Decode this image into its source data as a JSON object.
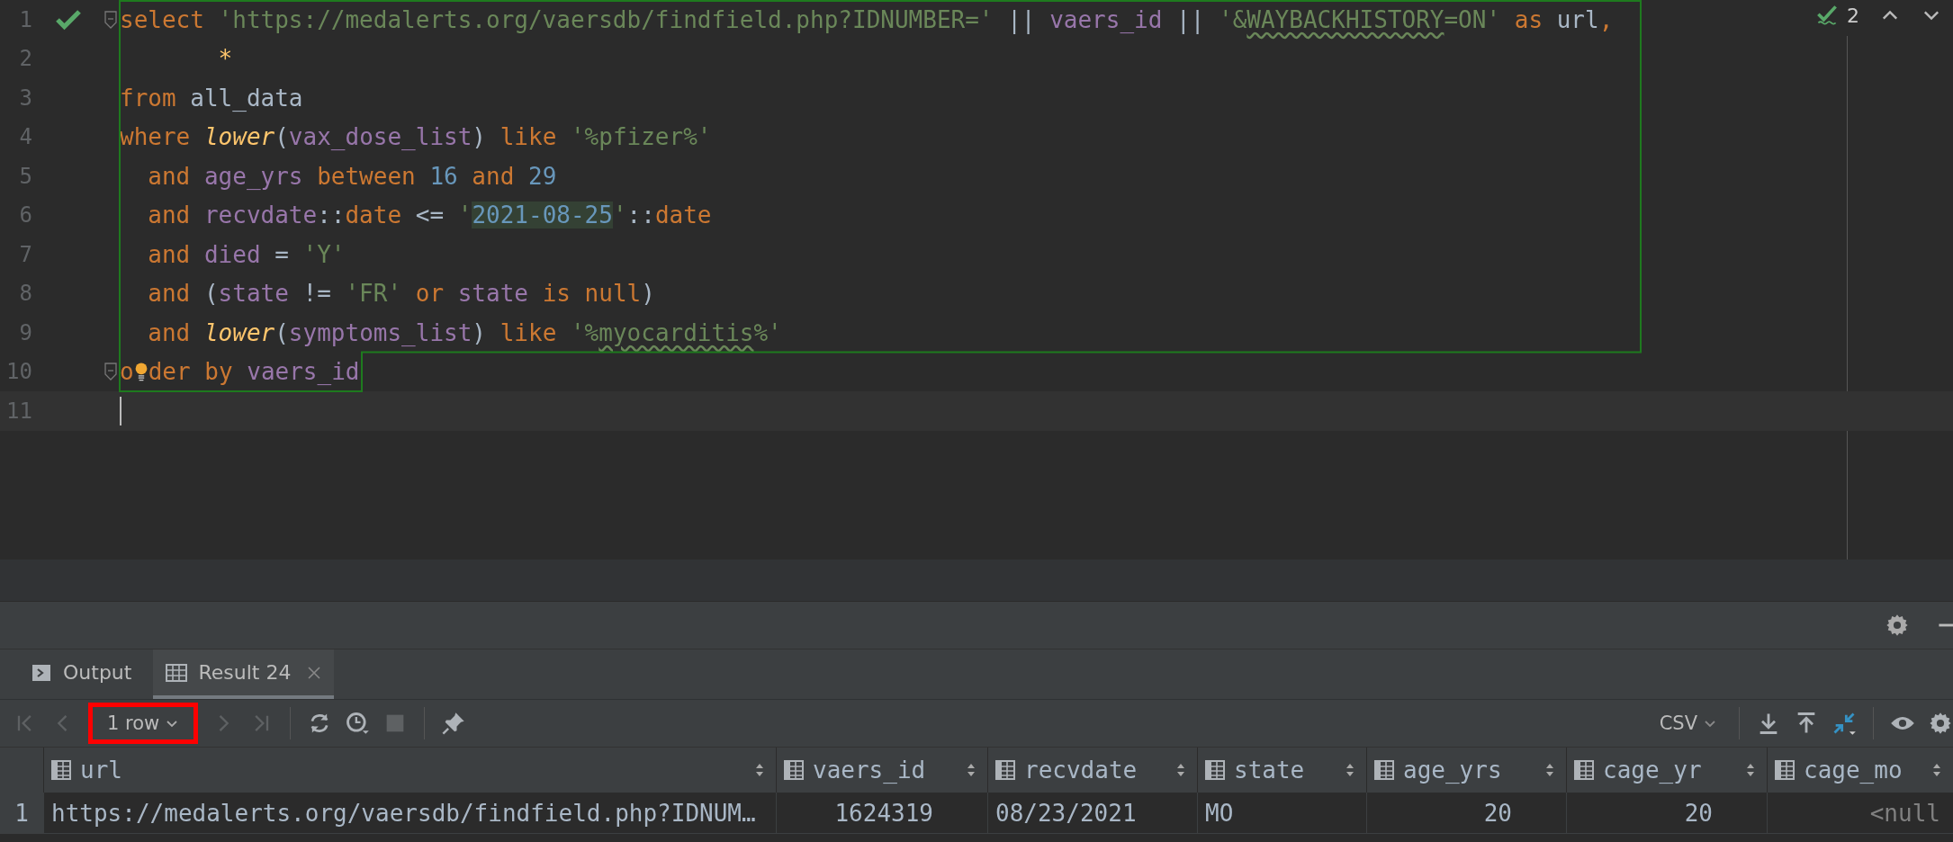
{
  "editor": {
    "lines": [
      {
        "number": "1",
        "ok_mark": true,
        "fold_marker": true,
        "tokens": [
          {
            "kind": "kw",
            "text": "select "
          },
          {
            "kind": "str",
            "text": "'https://medalerts.org/vaersdb/findfield.php?IDNUMBER=' "
          },
          {
            "kind": "plain",
            "text": "|| "
          },
          {
            "kind": "col",
            "text": "vaers_id "
          },
          {
            "kind": "plain",
            "text": "|| "
          },
          {
            "kind": "str",
            "text": "'&"
          },
          {
            "kind": "typo",
            "text": "WAYBACKHISTORY"
          },
          {
            "kind": "str",
            "text": "=ON' "
          },
          {
            "kind": "kw",
            "text": "as "
          },
          {
            "kind": "plain",
            "text": "url"
          },
          {
            "kind": "kw",
            "text": ","
          }
        ]
      },
      {
        "number": "2",
        "tokens": [
          {
            "kind": "star",
            "text": "       *"
          }
        ]
      },
      {
        "number": "3",
        "tokens": [
          {
            "kind": "kw",
            "text": "from "
          },
          {
            "kind": "plain",
            "text": "all_data"
          }
        ]
      },
      {
        "number": "4",
        "tokens": [
          {
            "kind": "kw",
            "text": "where "
          },
          {
            "kind": "fn",
            "text": "lower"
          },
          {
            "kind": "plain",
            "text": "("
          },
          {
            "kind": "col",
            "text": "vax_dose_list"
          },
          {
            "kind": "plain",
            "text": ") "
          },
          {
            "kind": "kw",
            "text": "like "
          },
          {
            "kind": "str",
            "text": "'%pfizer%'"
          }
        ]
      },
      {
        "number": "5",
        "tokens": [
          {
            "kind": "kw",
            "text": "  and "
          },
          {
            "kind": "col",
            "text": "age_yrs "
          },
          {
            "kind": "kw",
            "text": "between "
          },
          {
            "kind": "num",
            "text": "16 "
          },
          {
            "kind": "kw",
            "text": "and "
          },
          {
            "kind": "num",
            "text": "29"
          }
        ]
      },
      {
        "number": "6",
        "tokens": [
          {
            "kind": "kw",
            "text": "  and "
          },
          {
            "kind": "col",
            "text": "recvdate"
          },
          {
            "kind": "plain",
            "text": "::"
          },
          {
            "kind": "kw",
            "text": "date "
          },
          {
            "kind": "plain",
            "text": "<= "
          },
          {
            "kind": "str",
            "text": "'"
          },
          {
            "kind": "date",
            "text": "2021-08-25"
          },
          {
            "kind": "str",
            "text": "'"
          },
          {
            "kind": "plain",
            "text": "::"
          },
          {
            "kind": "kw",
            "text": "date"
          }
        ]
      },
      {
        "number": "7",
        "tokens": [
          {
            "kind": "kw",
            "text": "  and "
          },
          {
            "kind": "col",
            "text": "died "
          },
          {
            "kind": "plain",
            "text": "= "
          },
          {
            "kind": "str",
            "text": "'Y'"
          }
        ]
      },
      {
        "number": "8",
        "tokens": [
          {
            "kind": "kw",
            "text": "  and "
          },
          {
            "kind": "plain",
            "text": "("
          },
          {
            "kind": "col",
            "text": "state "
          },
          {
            "kind": "plain",
            "text": "!= "
          },
          {
            "kind": "str",
            "text": "'FR' "
          },
          {
            "kind": "kw",
            "text": "or "
          },
          {
            "kind": "col",
            "text": "state "
          },
          {
            "kind": "kw",
            "text": "is null"
          },
          {
            "kind": "plain",
            "text": ")"
          }
        ]
      },
      {
        "number": "9",
        "tokens": [
          {
            "kind": "kw",
            "text": "  and "
          },
          {
            "kind": "fn",
            "text": "lower"
          },
          {
            "kind": "plain",
            "text": "("
          },
          {
            "kind": "col",
            "text": "symptoms_list"
          },
          {
            "kind": "plain",
            "text": ") "
          },
          {
            "kind": "kw",
            "text": "like "
          },
          {
            "kind": "str",
            "text": "'%"
          },
          {
            "kind": "typo",
            "text": "myocarditis"
          },
          {
            "kind": "str",
            "text": "%'"
          }
        ]
      },
      {
        "number": "10",
        "fold_marker": true,
        "bulb": true,
        "tokens": [
          {
            "kind": "kw",
            "text": "o"
          },
          {
            "kind": "kw",
            "text": "der by "
          },
          {
            "kind": "col",
            "text": "vaers_id"
          }
        ]
      },
      {
        "number": "11",
        "caret": true
      }
    ],
    "inspection_count": "2"
  },
  "results": {
    "tabs": [
      {
        "label": "Output",
        "selected": false,
        "closable": false
      },
      {
        "label": "Result 24",
        "selected": true,
        "closable": true
      }
    ],
    "paging": {
      "label": "1 row",
      "highlighted": true
    },
    "format": "CSV",
    "table": {
      "columns": [
        {
          "name": "url",
          "kind": "text"
        },
        {
          "name": "vaers_id",
          "kind": "numeric"
        },
        {
          "name": "recvdate",
          "kind": "text"
        },
        {
          "name": "state",
          "kind": "text"
        },
        {
          "name": "age_yrs",
          "kind": "numeric"
        },
        {
          "name": "cage_yr",
          "kind": "numeric"
        },
        {
          "name": "cage_mo",
          "kind": "numeric"
        }
      ],
      "rows": [
        {
          "number": "1",
          "cells": [
            {
              "text": "https://medalerts.org/vaersdb/findfield.php?IDNUM…",
              "kind": "value"
            },
            {
              "text": "1624319",
              "kind": "value"
            },
            {
              "text": "08/23/2021",
              "kind": "value"
            },
            {
              "text": "MO",
              "kind": "value"
            },
            {
              "text": "20",
              "kind": "value"
            },
            {
              "text": "20",
              "kind": "value"
            },
            {
              "text": "<null",
              "kind": "null"
            }
          ]
        }
      ]
    }
  }
}
